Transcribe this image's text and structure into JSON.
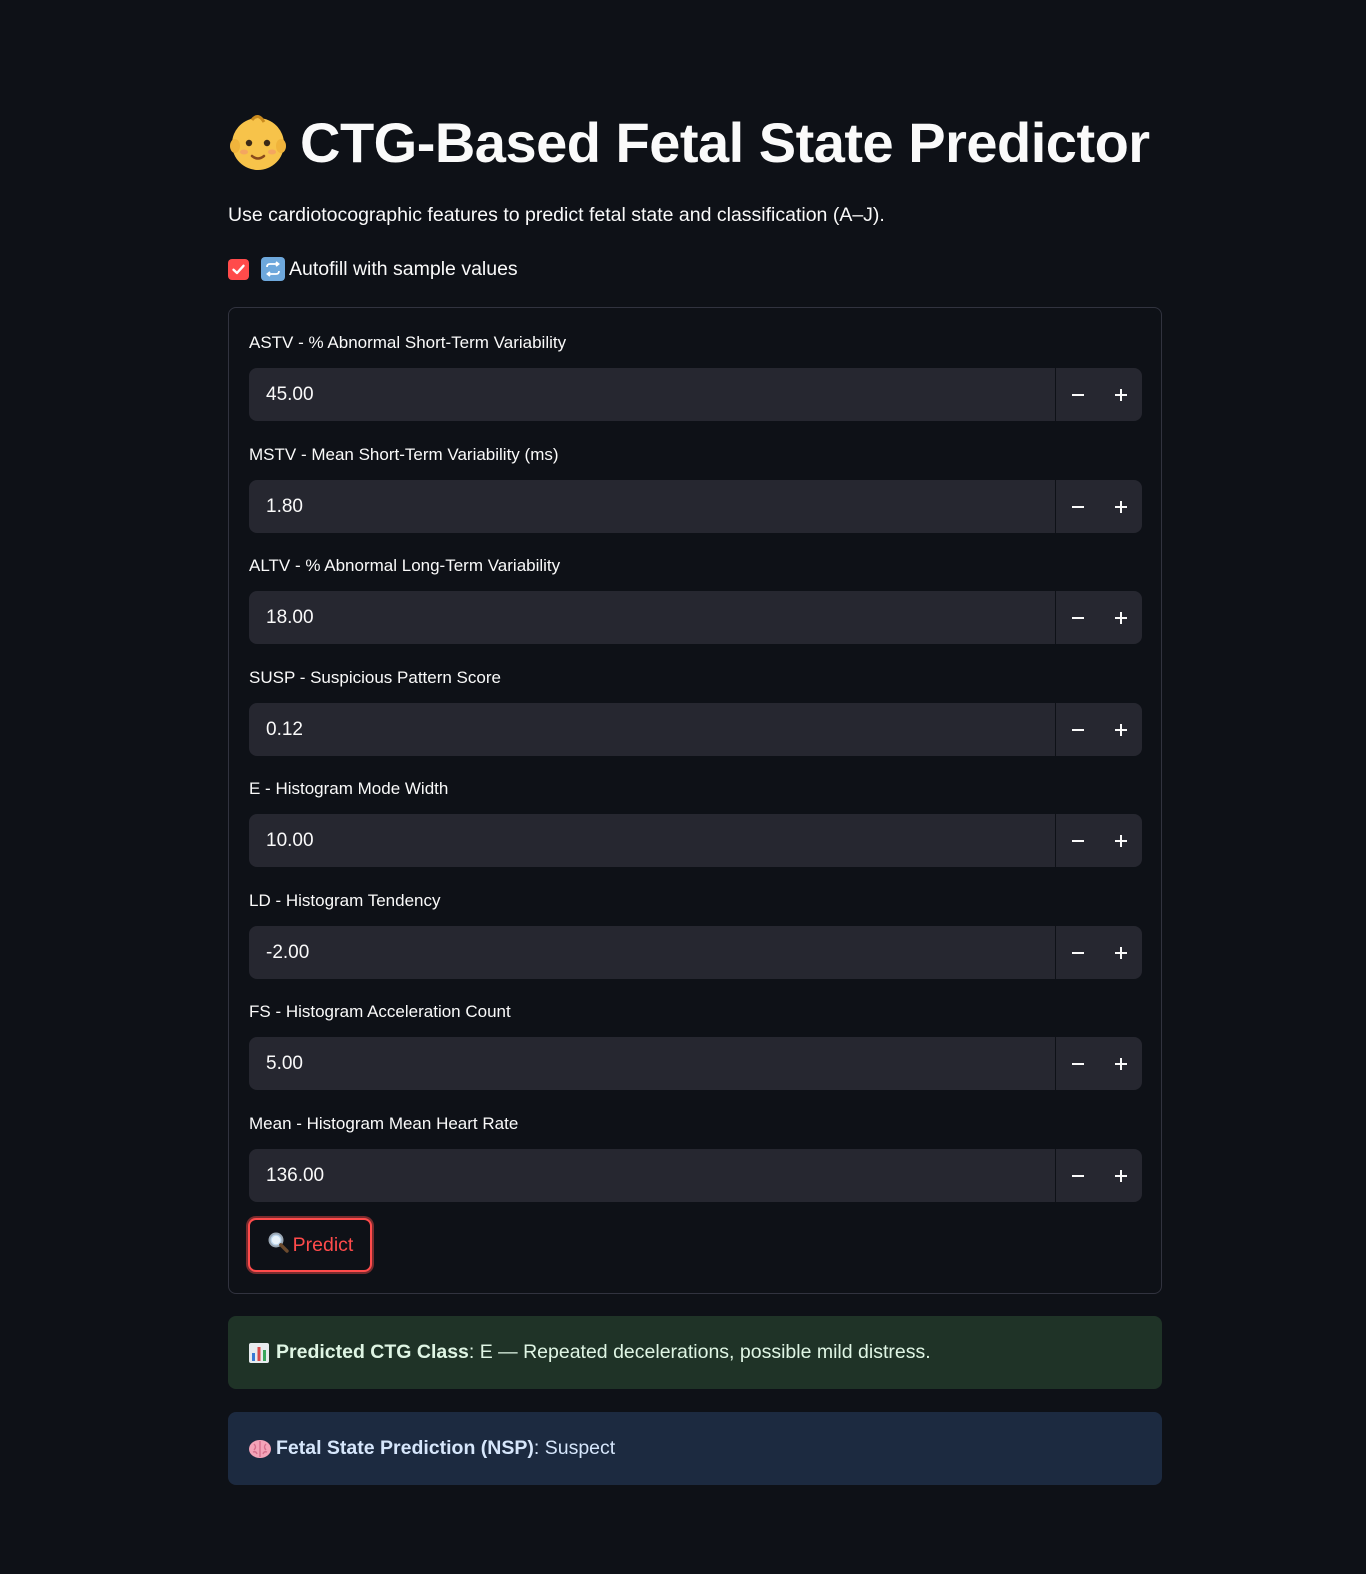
{
  "header": {
    "title": "CTG-Based Fetal State Predictor",
    "title_icon": "baby-face-icon",
    "subtitle": "Use cardiotocographic features to predict fetal state and classification (A–J)."
  },
  "autofill": {
    "label": "Autofill with sample values",
    "checked": true,
    "icon": "refresh-icon"
  },
  "form": {
    "fields": [
      {
        "label": "ASTV - % Abnormal Short-Term Variability",
        "value": "45.00"
      },
      {
        "label": "MSTV - Mean Short-Term Variability (ms)",
        "value": "1.80"
      },
      {
        "label": "ALTV - % Abnormal Long-Term Variability",
        "value": "18.00"
      },
      {
        "label": "SUSP - Suspicious Pattern Score",
        "value": "0.12"
      },
      {
        "label": "E - Histogram Mode Width",
        "value": "10.00"
      },
      {
        "label": "LD - Histogram Tendency",
        "value": "-2.00"
      },
      {
        "label": "FS - Histogram Acceleration Count",
        "value": "5.00"
      },
      {
        "label": "Mean - Histogram Mean Heart Rate",
        "value": "136.00"
      }
    ],
    "minus_symbol": "−",
    "plus_symbol": "+",
    "predict_label": "Predict",
    "predict_icon": "search-icon"
  },
  "results": {
    "class_label": "Predicted CTG Class",
    "class_value": ": E — Repeated decelerations, possible mild distress.",
    "class_icon": "bar-chart-icon",
    "nsp_label": "Fetal State Prediction (NSP)",
    "nsp_value": ": Suspect",
    "nsp_icon": "brain-icon"
  },
  "colors": {
    "background": "#0e1117",
    "accent": "#ff4b4b",
    "input_bg": "#262730",
    "success_bg": "#1f3327",
    "info_bg": "#1c2a40"
  }
}
